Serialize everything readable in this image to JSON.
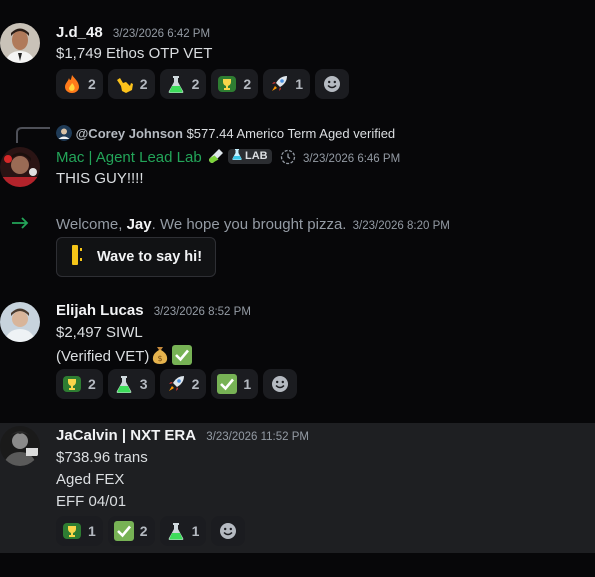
{
  "colors": {
    "background": "#070709",
    "reaction_bg": "#1b1c20",
    "username": "#f2f3f5",
    "role_green": "#23a559",
    "timestamp": "#949ba4",
    "highlight_bg": "#1e1f22"
  },
  "messages": [
    {
      "username": "J.d_48",
      "timestamp": "3/23/2026 6:42 PM",
      "lines": [
        "$1,749 Ethos OTP VET"
      ],
      "reactions": [
        {
          "icon": "fire-emoji",
          "glyph": "🔥",
          "count": "2"
        },
        {
          "icon": "call-me-hand-emoji",
          "glyph": "🤙",
          "count": "2"
        },
        {
          "icon": "flask-emoji",
          "glyph": "⚗",
          "count": "2"
        },
        {
          "icon": "trophy-emoji",
          "glyph": "🏆",
          "count": "2"
        },
        {
          "icon": "rocket-emoji",
          "glyph": "🚀",
          "count": "1"
        }
      ]
    },
    {
      "reply_to_user": "@Corey Johnson",
      "reply_preview": "$577.44 Americo Term  Aged verified",
      "username": "Mac | Agent Lead Lab",
      "tag": "LAB",
      "timestamp": "3/23/2026 6:46 PM",
      "lines": [
        "THIS GUY!!!!"
      ]
    },
    {
      "system_text_before": "Welcome, ",
      "system_user": "Jay",
      "system_text_after": ". We hope you brought pizza.",
      "timestamp": "3/23/2026 8:20 PM",
      "button_label": "Wave to say hi!"
    },
    {
      "username": "Elijah Lucas",
      "timestamp": "3/23/2026 8:52 PM",
      "lines": [
        "$2,497 SIWL",
        "(Verified VET)"
      ],
      "reactions": [
        {
          "icon": "trophy-emoji",
          "glyph": "🏆",
          "count": "2"
        },
        {
          "icon": "flask-emoji",
          "glyph": "⚗",
          "count": "3"
        },
        {
          "icon": "rocket-emoji",
          "glyph": "🚀",
          "count": "2"
        },
        {
          "icon": "check-mark-emoji",
          "glyph": "✔",
          "count": "1"
        }
      ]
    },
    {
      "username": "JaCalvin | NXT ERA",
      "timestamp": "3/23/2026 11:52 PM",
      "lines": [
        "$738.96 trans",
        "Aged FEX",
        "EFF 04/01"
      ],
      "reactions": [
        {
          "icon": "trophy-emoji",
          "glyph": "🏆",
          "count": "1"
        },
        {
          "icon": "check-mark-emoji",
          "glyph": "✔",
          "count": "2"
        },
        {
          "icon": "flask-emoji",
          "glyph": "⚗",
          "count": "1"
        }
      ]
    }
  ]
}
